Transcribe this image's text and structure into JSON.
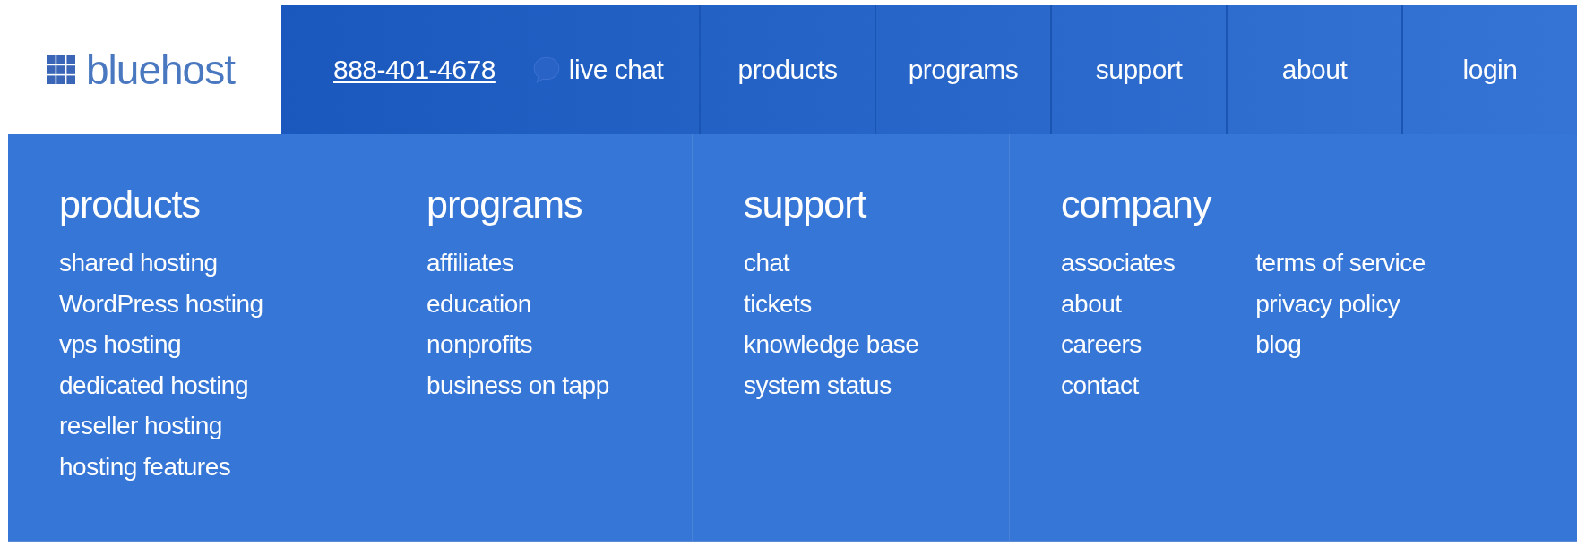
{
  "header": {
    "logo": "bluehost",
    "phone": "888-401-4678",
    "live_chat": "live chat",
    "nav": [
      "products",
      "programs",
      "support",
      "about",
      "login"
    ]
  },
  "menu": {
    "columns": [
      {
        "title": "products",
        "lists": [
          [
            "shared hosting",
            "WordPress hosting",
            "vps hosting",
            "dedicated hosting",
            "reseller hosting",
            "hosting features"
          ]
        ]
      },
      {
        "title": "programs",
        "lists": [
          [
            "affiliates",
            "education",
            "nonprofits",
            "business on tapp"
          ]
        ]
      },
      {
        "title": "support",
        "lists": [
          [
            "chat",
            "tickets",
            "knowledge base",
            "system status"
          ]
        ]
      },
      {
        "title": "company",
        "lists": [
          [
            "associates",
            "about",
            "careers",
            "contact"
          ],
          [
            "terms of service",
            "privacy policy",
            "blog"
          ]
        ]
      }
    ]
  }
}
